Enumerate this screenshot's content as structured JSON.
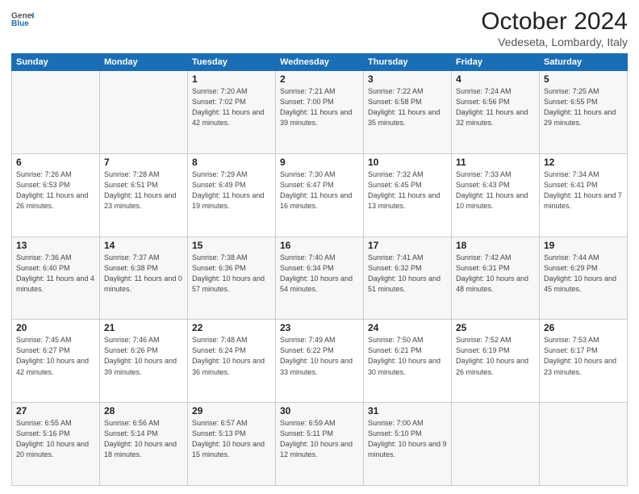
{
  "header": {
    "logo_general": "General",
    "logo_blue": "Blue",
    "month": "October 2024",
    "location": "Vedeseta, Lombardy, Italy"
  },
  "days_of_week": [
    "Sunday",
    "Monday",
    "Tuesday",
    "Wednesday",
    "Thursday",
    "Friday",
    "Saturday"
  ],
  "weeks": [
    [
      {
        "day": "",
        "empty": true
      },
      {
        "day": "",
        "empty": true
      },
      {
        "day": "1",
        "sunrise": "Sunrise: 7:20 AM",
        "sunset": "Sunset: 7:02 PM",
        "daylight": "Daylight: 11 hours and 42 minutes."
      },
      {
        "day": "2",
        "sunrise": "Sunrise: 7:21 AM",
        "sunset": "Sunset: 7:00 PM",
        "daylight": "Daylight: 11 hours and 39 minutes."
      },
      {
        "day": "3",
        "sunrise": "Sunrise: 7:22 AM",
        "sunset": "Sunset: 6:58 PM",
        "daylight": "Daylight: 11 hours and 35 minutes."
      },
      {
        "day": "4",
        "sunrise": "Sunrise: 7:24 AM",
        "sunset": "Sunset: 6:56 PM",
        "daylight": "Daylight: 11 hours and 32 minutes."
      },
      {
        "day": "5",
        "sunrise": "Sunrise: 7:25 AM",
        "sunset": "Sunset: 6:55 PM",
        "daylight": "Daylight: 11 hours and 29 minutes."
      }
    ],
    [
      {
        "day": "6",
        "sunrise": "Sunrise: 7:26 AM",
        "sunset": "Sunset: 6:53 PM",
        "daylight": "Daylight: 11 hours and 26 minutes."
      },
      {
        "day": "7",
        "sunrise": "Sunrise: 7:28 AM",
        "sunset": "Sunset: 6:51 PM",
        "daylight": "Daylight: 11 hours and 23 minutes."
      },
      {
        "day": "8",
        "sunrise": "Sunrise: 7:29 AM",
        "sunset": "Sunset: 6:49 PM",
        "daylight": "Daylight: 11 hours and 19 minutes."
      },
      {
        "day": "9",
        "sunrise": "Sunrise: 7:30 AM",
        "sunset": "Sunset: 6:47 PM",
        "daylight": "Daylight: 11 hours and 16 minutes."
      },
      {
        "day": "10",
        "sunrise": "Sunrise: 7:32 AM",
        "sunset": "Sunset: 6:45 PM",
        "daylight": "Daylight: 11 hours and 13 minutes."
      },
      {
        "day": "11",
        "sunrise": "Sunrise: 7:33 AM",
        "sunset": "Sunset: 6:43 PM",
        "daylight": "Daylight: 11 hours and 10 minutes."
      },
      {
        "day": "12",
        "sunrise": "Sunrise: 7:34 AM",
        "sunset": "Sunset: 6:41 PM",
        "daylight": "Daylight: 11 hours and 7 minutes."
      }
    ],
    [
      {
        "day": "13",
        "sunrise": "Sunrise: 7:36 AM",
        "sunset": "Sunset: 6:40 PM",
        "daylight": "Daylight: 11 hours and 4 minutes."
      },
      {
        "day": "14",
        "sunrise": "Sunrise: 7:37 AM",
        "sunset": "Sunset: 6:38 PM",
        "daylight": "Daylight: 11 hours and 0 minutes."
      },
      {
        "day": "15",
        "sunrise": "Sunrise: 7:38 AM",
        "sunset": "Sunset: 6:36 PM",
        "daylight": "Daylight: 10 hours and 57 minutes."
      },
      {
        "day": "16",
        "sunrise": "Sunrise: 7:40 AM",
        "sunset": "Sunset: 6:34 PM",
        "daylight": "Daylight: 10 hours and 54 minutes."
      },
      {
        "day": "17",
        "sunrise": "Sunrise: 7:41 AM",
        "sunset": "Sunset: 6:32 PM",
        "daylight": "Daylight: 10 hours and 51 minutes."
      },
      {
        "day": "18",
        "sunrise": "Sunrise: 7:42 AM",
        "sunset": "Sunset: 6:31 PM",
        "daylight": "Daylight: 10 hours and 48 minutes."
      },
      {
        "day": "19",
        "sunrise": "Sunrise: 7:44 AM",
        "sunset": "Sunset: 6:29 PM",
        "daylight": "Daylight: 10 hours and 45 minutes."
      }
    ],
    [
      {
        "day": "20",
        "sunrise": "Sunrise: 7:45 AM",
        "sunset": "Sunset: 6:27 PM",
        "daylight": "Daylight: 10 hours and 42 minutes."
      },
      {
        "day": "21",
        "sunrise": "Sunrise: 7:46 AM",
        "sunset": "Sunset: 6:26 PM",
        "daylight": "Daylight: 10 hours and 39 minutes."
      },
      {
        "day": "22",
        "sunrise": "Sunrise: 7:48 AM",
        "sunset": "Sunset: 6:24 PM",
        "daylight": "Daylight: 10 hours and 36 minutes."
      },
      {
        "day": "23",
        "sunrise": "Sunrise: 7:49 AM",
        "sunset": "Sunset: 6:22 PM",
        "daylight": "Daylight: 10 hours and 33 minutes."
      },
      {
        "day": "24",
        "sunrise": "Sunrise: 7:50 AM",
        "sunset": "Sunset: 6:21 PM",
        "daylight": "Daylight: 10 hours and 30 minutes."
      },
      {
        "day": "25",
        "sunrise": "Sunrise: 7:52 AM",
        "sunset": "Sunset: 6:19 PM",
        "daylight": "Daylight: 10 hours and 26 minutes."
      },
      {
        "day": "26",
        "sunrise": "Sunrise: 7:53 AM",
        "sunset": "Sunset: 6:17 PM",
        "daylight": "Daylight: 10 hours and 23 minutes."
      }
    ],
    [
      {
        "day": "27",
        "sunrise": "Sunrise: 6:55 AM",
        "sunset": "Sunset: 5:16 PM",
        "daylight": "Daylight: 10 hours and 20 minutes."
      },
      {
        "day": "28",
        "sunrise": "Sunrise: 6:56 AM",
        "sunset": "Sunset: 5:14 PM",
        "daylight": "Daylight: 10 hours and 18 minutes."
      },
      {
        "day": "29",
        "sunrise": "Sunrise: 6:57 AM",
        "sunset": "Sunset: 5:13 PM",
        "daylight": "Daylight: 10 hours and 15 minutes."
      },
      {
        "day": "30",
        "sunrise": "Sunrise: 6:59 AM",
        "sunset": "Sunset: 5:11 PM",
        "daylight": "Daylight: 10 hours and 12 minutes."
      },
      {
        "day": "31",
        "sunrise": "Sunrise: 7:00 AM",
        "sunset": "Sunset: 5:10 PM",
        "daylight": "Daylight: 10 hours and 9 minutes."
      },
      {
        "day": "",
        "empty": true
      },
      {
        "day": "",
        "empty": true
      }
    ]
  ]
}
